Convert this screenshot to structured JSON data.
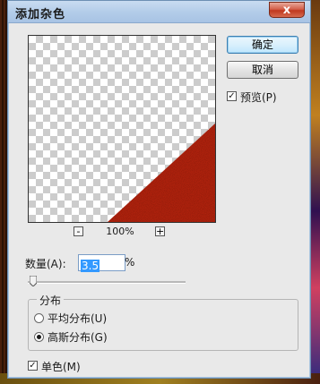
{
  "dialog": {
    "title": "添加杂色",
    "close_label": "x"
  },
  "buttons": {
    "ok_label": "确定",
    "cancel_label": "取消"
  },
  "preview_option": {
    "label": "预览(P)",
    "checked": true,
    "check_glyph": "✓"
  },
  "zoom": {
    "minus_label": "-",
    "plus_label": "+",
    "level_text": "100%"
  },
  "amount": {
    "label": "数量(A):",
    "value": "3.5",
    "unit": "%",
    "slider_fraction": 0.0088
  },
  "distribution": {
    "title": "分布",
    "options": [
      {
        "label": "平均分布(U)",
        "selected": false
      },
      {
        "label": "高斯分布(G)",
        "selected": true
      }
    ]
  },
  "monochrome": {
    "label": "单色(M)",
    "checked": true,
    "check_glyph": "✓"
  },
  "colors": {
    "title_bar": "#b4cde9",
    "close_button": "#c0391f",
    "preview_fill": "#c8260e",
    "selection": "#3399ff"
  }
}
